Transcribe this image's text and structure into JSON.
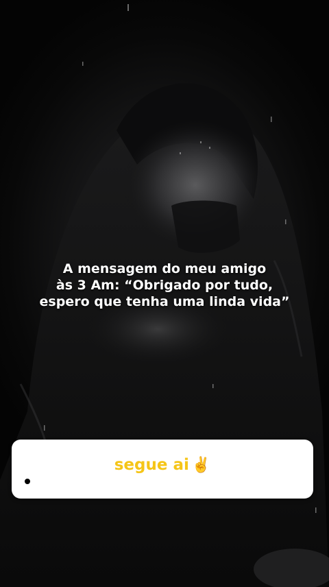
{
  "caption": {
    "lines": [
      "A mensagem do meu amigo",
      "às 3 Am: “Obrigado por tudo,",
      "espero que tenha uma linda vida”"
    ]
  },
  "sticker": {
    "text": "segue ai",
    "icon": "✌️",
    "text_color": "#f5c518",
    "background_color": "#ffffff"
  }
}
